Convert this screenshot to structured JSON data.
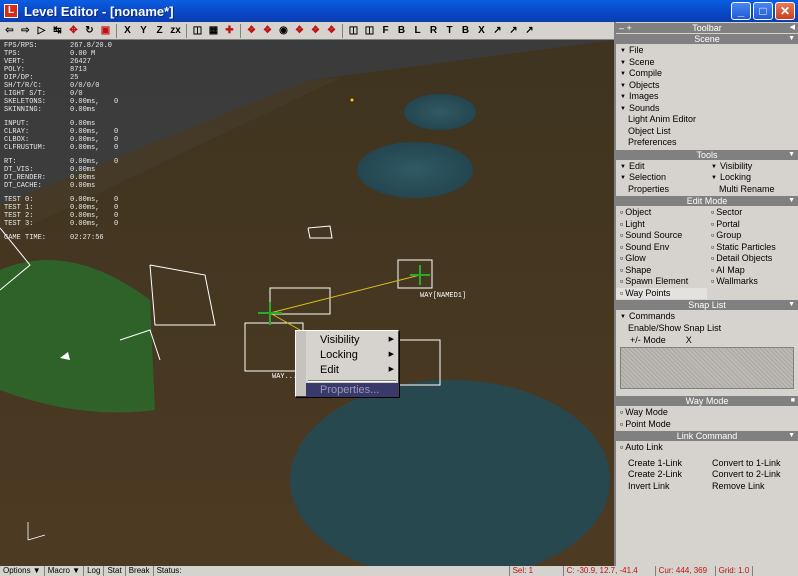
{
  "window": {
    "title": "Level Editor - [noname*]",
    "app_icon": "L"
  },
  "toolbar": {
    "axis_labels": [
      "X",
      "Y",
      "Z",
      "zx"
    ],
    "letters": [
      "F",
      "B",
      "L",
      "R",
      "T",
      "B",
      "X"
    ]
  },
  "stats": [
    [
      "FPS/RPS:",
      "267.8/20.0",
      ""
    ],
    [
      "TPS:",
      "0.00 M",
      ""
    ],
    [
      "VERT:",
      "26427",
      ""
    ],
    [
      "POLY:",
      "8713",
      ""
    ],
    [
      "DIP/DP:",
      "25",
      ""
    ],
    [
      "SH/T/R/C:",
      "0/0/0/0",
      ""
    ],
    [
      "LIGHT S/T:",
      "0/0",
      ""
    ],
    [
      "SKELETONS:",
      "0.00ms,",
      "0"
    ],
    [
      "SKINNING:",
      "0.00ms",
      ""
    ],
    [
      "",
      "",
      ""
    ],
    [
      "INPUT:",
      "0.00ms",
      ""
    ],
    [
      "CLRAY:",
      "0.00ms,",
      "0"
    ],
    [
      "CLBOX:",
      "0.00ms,",
      "0"
    ],
    [
      "CLFRUSTUM:",
      "0.00ms,",
      "0"
    ],
    [
      "",
      "",
      ""
    ],
    [
      "RT:",
      "0.00ms,",
      "0"
    ],
    [
      "DT_VIS:",
      "0.00ms",
      ""
    ],
    [
      "DT_RENDER:",
      "0.00ms",
      ""
    ],
    [
      "DT_CACHE:",
      "0.00ms",
      ""
    ],
    [
      "",
      "",
      ""
    ],
    [
      "TEST 0:",
      "0.00ms,",
      "0"
    ],
    [
      "TEST 1:",
      "0.00ms,",
      "0"
    ],
    [
      "TEST 2:",
      "0.00ms,",
      "0"
    ],
    [
      "TEST 3:",
      "0.00ms,",
      "0"
    ],
    [
      "",
      "",
      ""
    ],
    [
      "GAME TIME:",
      "02:27:56",
      ""
    ]
  ],
  "viewport_labels": {
    "way_named": "WAY[NAMED1]",
    "way_short": "WAY..."
  },
  "context_menu": {
    "visibility": "Visibility",
    "locking": "Locking",
    "edit": "Edit",
    "properties": "Properties..."
  },
  "panel": {
    "toolbar_title": "Toolbar",
    "scene": {
      "title": "Scene",
      "items": [
        "File",
        "Scene",
        "Compile",
        "Objects",
        "Images",
        "Sounds"
      ],
      "links": [
        "Light Anim Editor",
        "Object List",
        "Preferences"
      ]
    },
    "tools": {
      "title": "Tools",
      "edit": "Edit",
      "visibility": "Visibility",
      "selection": "Selection",
      "locking": "Locking",
      "properties": "Properties",
      "multi_rename": "Multi Rename"
    },
    "edit_mode": {
      "title": "Edit Mode",
      "left": [
        "Object",
        "Light",
        "Sound Source",
        "Sound Env",
        "Glow",
        "Shape",
        "Spawn Element",
        "Way Points"
      ],
      "right": [
        "Sector",
        "Portal",
        "Group",
        "Static Particles",
        "Detail Objects",
        "AI Map",
        "Wallmarks"
      ]
    },
    "snap_list": {
      "title": "Snap List",
      "commands": "Commands",
      "enable_show": "Enable/Show Snap List",
      "mode": "+/- Mode",
      "x": "X"
    },
    "way_mode": {
      "title": "Way Mode",
      "way": "Way Mode",
      "point": "Point Mode"
    },
    "link_command": {
      "title": "Link Command",
      "auto_link": "Auto Link",
      "create_1": "Create 1-Link",
      "convert_1": "Convert to 1-Link",
      "create_2": "Create 2-Link",
      "convert_2": "Convert to 2-Link",
      "invert": "Invert Link",
      "remove": "Remove Link"
    }
  },
  "statusbar": {
    "options": "Options",
    "macro": "Macro",
    "log": "Log",
    "stat": "Stat",
    "break": "Break",
    "status": "Status:",
    "sel": "Sel: 1",
    "coords": "C: -30.9, 12.7, -41.4",
    "cur": "Cur: 444, 369",
    "grid": "Grid: 1.0"
  },
  "colors": {
    "titlebar": "#0846c4",
    "panel_bg": "#d6d3ce",
    "ground": "#4a3a22",
    "water": "#2a4a52",
    "selection_green": "#2a8a2a"
  }
}
